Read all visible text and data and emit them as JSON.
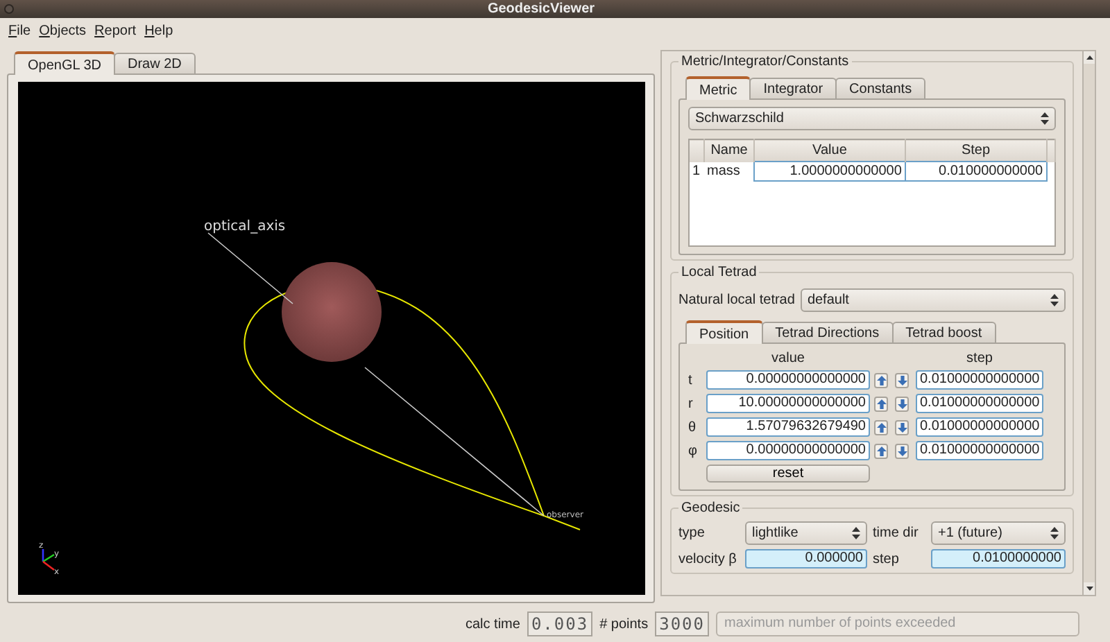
{
  "window": {
    "title": "GeodesicViewer"
  },
  "menu": [
    {
      "label": "File"
    },
    {
      "label": "Objects"
    },
    {
      "label": "Report"
    },
    {
      "label": "Help"
    }
  ],
  "view_tabs": [
    {
      "label": "OpenGL 3D",
      "selected": true
    },
    {
      "label": "Draw 2D",
      "selected": false
    }
  ],
  "scene": {
    "axis_label": "optical_axis",
    "observer_label": "observer",
    "axes": [
      "z",
      "y",
      "x"
    ]
  },
  "metric_group": {
    "title": "Metric/Integrator/Constants",
    "tabs": [
      {
        "label": "Metric",
        "selected": true
      },
      {
        "label": "Integrator",
        "selected": false
      },
      {
        "label": "Constants",
        "selected": false
      }
    ],
    "metric": "Schwarzschild",
    "table": {
      "columns": [
        "Name",
        "Value",
        "Step"
      ],
      "rows": [
        {
          "number": "1",
          "name": "mass",
          "value": "1.0000000000000",
          "step": "0.010000000000"
        }
      ]
    }
  },
  "tetrad_group": {
    "title": "Local Tetrad",
    "natural_label": "Natural local tetrad",
    "natural_value": "default",
    "tabs": [
      {
        "label": "Position",
        "selected": true
      },
      {
        "label": "Tetrad Directions",
        "selected": false
      },
      {
        "label": "Tetrad boost",
        "selected": false
      }
    ],
    "columns": [
      "value",
      "step"
    ],
    "rows": [
      {
        "symbol": "t",
        "value": "0.00000000000000",
        "step": "0.01000000000000"
      },
      {
        "symbol": "r",
        "value": "10.00000000000000",
        "step": "0.01000000000000"
      },
      {
        "symbol": "θ",
        "value": "1.57079632679490",
        "step": "0.01000000000000"
      },
      {
        "symbol": "φ",
        "value": "0.00000000000000",
        "step": "0.01000000000000"
      }
    ],
    "reset_button": "reset"
  },
  "geodesic_group": {
    "title": "Geodesic",
    "type_label": "type",
    "type_value": "lightlike",
    "time_dir_label": "time dir",
    "time_dir_value": "+1 (future)",
    "velocity_label": "velocity β",
    "velocity_value": "0.000000",
    "step_label": "step",
    "step_value": "0.0100000000"
  },
  "status_bar": {
    "calc_time_label": "calc time",
    "calc_time": "0.003",
    "points_label": "# points",
    "points": "3000",
    "message": "maximum number of points exceeded"
  }
}
